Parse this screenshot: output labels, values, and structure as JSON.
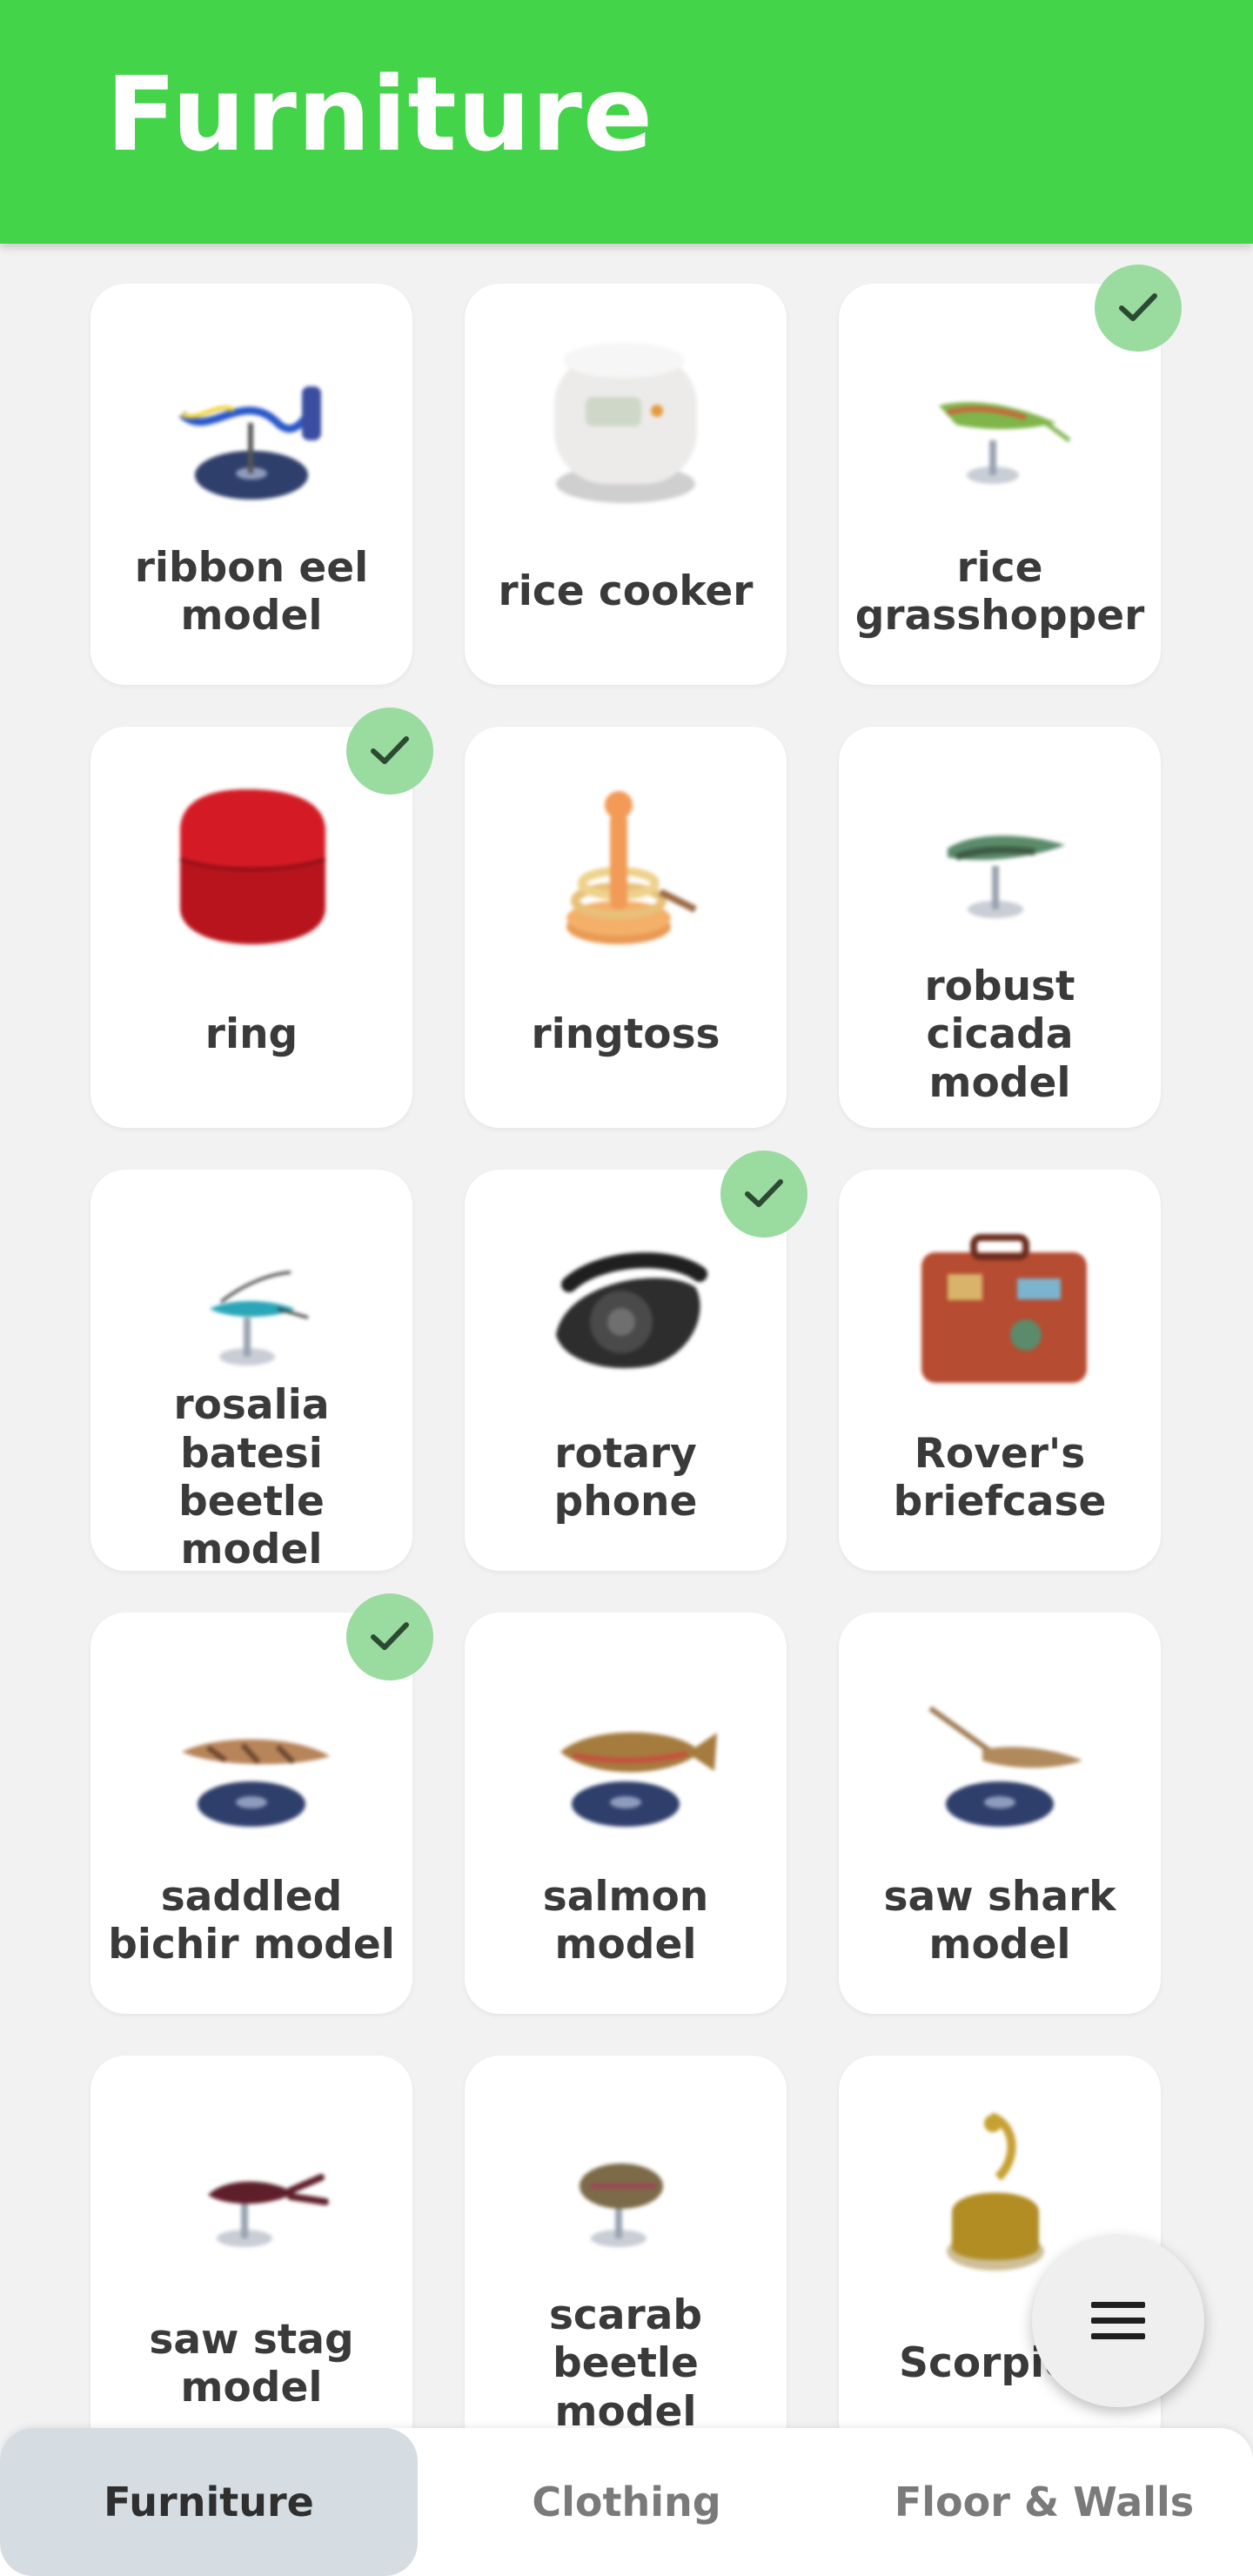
{
  "app": {
    "title": "Furniture"
  },
  "items": [
    {
      "name": "ribbon eel model",
      "checked": false,
      "icon": "ribbon-eel-model-icon"
    },
    {
      "name": "rice cooker",
      "checked": false,
      "icon": "rice-cooker-icon"
    },
    {
      "name": "rice grasshopper",
      "checked": true,
      "icon": "rice-grasshopper-icon"
    },
    {
      "name": "ring",
      "checked": true,
      "icon": "ring-box-icon"
    },
    {
      "name": "ringtoss",
      "checked": false,
      "icon": "ringtoss-icon"
    },
    {
      "name": "robust cicada model",
      "checked": false,
      "icon": "robust-cicada-model-icon"
    },
    {
      "name": "rosalia batesi beetle model",
      "checked": false,
      "icon": "rosalia-beetle-model-icon"
    },
    {
      "name": "rotary phone",
      "checked": true,
      "icon": "rotary-phone-icon"
    },
    {
      "name": "Rover's briefcase",
      "checked": false,
      "icon": "briefcase-icon"
    },
    {
      "name": "saddled bichir model",
      "checked": true,
      "icon": "saddled-bichir-model-icon"
    },
    {
      "name": "salmon model",
      "checked": false,
      "icon": "salmon-model-icon"
    },
    {
      "name": "saw shark model",
      "checked": false,
      "icon": "saw-shark-model-icon"
    },
    {
      "name": "saw stag model",
      "checked": false,
      "icon": "saw-stag-model-icon"
    },
    {
      "name": "scarab beetle model",
      "checked": false,
      "icon": "scarab-beetle-model-icon"
    },
    {
      "name": "Scorpio l",
      "checked": false,
      "icon": "scorpio-lamp-icon"
    }
  ],
  "fab": {
    "icon": "menu-icon"
  },
  "bottom_nav": {
    "tabs": [
      {
        "label": "Furniture",
        "active": true
      },
      {
        "label": "Clothing",
        "active": false
      },
      {
        "label": "Floor & Walls",
        "active": false
      }
    ]
  },
  "colors": {
    "appbar": "#43d44a",
    "check": "#9adba0",
    "active_tab": "#d5dde3"
  }
}
